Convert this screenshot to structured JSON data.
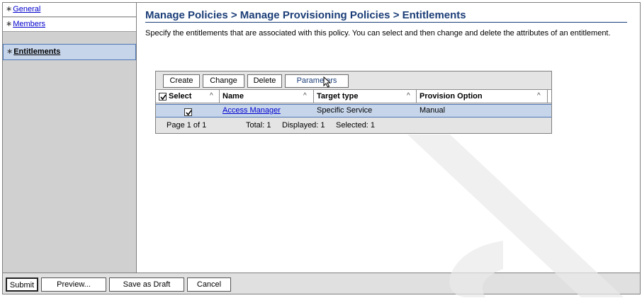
{
  "sidebar": {
    "items": [
      {
        "label": "General",
        "selected": false
      },
      {
        "label": "Members",
        "selected": false
      },
      {
        "label": "Entitlements",
        "selected": true
      }
    ],
    "bullet": "∗"
  },
  "main": {
    "title": "Manage Policies > Manage Provisioning Policies > Entitlements",
    "description": "Specify the entitlements that are associated with this policy. You can select and then change and delete the attributes of an entitlement."
  },
  "table": {
    "toolbar": [
      "Create",
      "Change",
      "Delete",
      "Parameters"
    ],
    "columns": [
      "Select",
      "Name",
      "Target type",
      "Provision Option"
    ],
    "sort_glyph": "^",
    "rows": [
      {
        "selected": true,
        "name": "Access Manager",
        "target_type": "Specific Service",
        "provision_option": "Manual"
      }
    ],
    "footer": {
      "page": "Page 1 of 1",
      "total": "Total: 1",
      "displayed": "Displayed: 1",
      "selected": "Selected: 1"
    }
  },
  "bottom": {
    "submit": "Submit",
    "preview": "Preview...",
    "save_draft": "Save as Draft",
    "cancel": "Cancel"
  },
  "colors": {
    "title": "#1c3e78",
    "selected_bg": "#c6d5ea",
    "link": "#0000cc"
  }
}
